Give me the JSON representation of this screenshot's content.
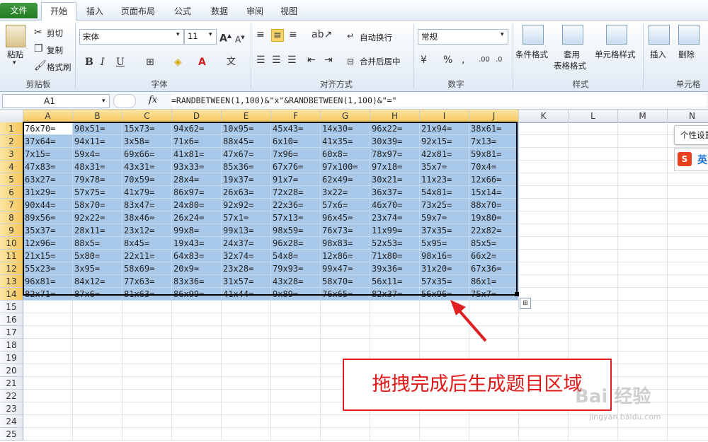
{
  "tabs": [
    "文件",
    "开始",
    "插入",
    "页面布局",
    "公式",
    "数据",
    "审阅",
    "视图"
  ],
  "clipboard": {
    "paste": "粘贴",
    "cut": "剪切",
    "copy": "复制",
    "format_painter": "格式刷",
    "label": "剪贴板"
  },
  "font": {
    "name": "宋体",
    "size": "11",
    "label": "字体"
  },
  "alignment": {
    "wrap": "自动换行",
    "merge": "合并后居中",
    "label": "对齐方式"
  },
  "number": {
    "format": "常规",
    "label": "数字"
  },
  "styles": {
    "conditional": "条件格式",
    "table1": "套用",
    "table2": "表格格式",
    "cell_styles": "单元格样式",
    "label": "样式"
  },
  "cells": {
    "insert": "插入",
    "delete": "删除",
    "label": "单元格"
  },
  "formula_bar": {
    "name_box": "A1",
    "fx": "fx",
    "formula": "=RANDBETWEEN(1,100)&\"x\"&RANDBETWEEN(1,100)&\"=\""
  },
  "columns": [
    "A",
    "B",
    "C",
    "D",
    "E",
    "F",
    "G",
    "H",
    "I",
    "J",
    "K",
    "L",
    "M",
    "N"
  ],
  "rows": [
    "1",
    "2",
    "3",
    "4",
    "5",
    "6",
    "7",
    "8",
    "9",
    "10",
    "11",
    "12",
    "13",
    "14",
    "15",
    "16",
    "17",
    "18",
    "19",
    "20",
    "21",
    "22",
    "23",
    "24",
    "25"
  ],
  "grid": [
    [
      "76x70=",
      "90x51=",
      "15x73=",
      "94x62=",
      "10x95=",
      "45x43=",
      "14x30=",
      "96x22=",
      "21x94=",
      "38x61="
    ],
    [
      "37x64=",
      "94x11=",
      "3x58=",
      "71x6=",
      "88x45=",
      "6x10=",
      "41x35=",
      "30x39=",
      "92x15=",
      "7x13="
    ],
    [
      "7x15=",
      "59x4=",
      "69x66=",
      "41x81=",
      "47x67=",
      "7x96=",
      "60x8=",
      "78x97=",
      "42x81=",
      "59x81="
    ],
    [
      "47x83=",
      "48x31=",
      "43x31=",
      "93x33=",
      "85x36=",
      "67x76=",
      "97x100=",
      "97x18=",
      "35x7=",
      "70x4="
    ],
    [
      "63x27=",
      "79x78=",
      "70x59=",
      "28x4=",
      "19x37=",
      "91x7=",
      "62x49=",
      "30x21=",
      "11x23=",
      "12x66="
    ],
    [
      "31x29=",
      "57x75=",
      "41x79=",
      "86x97=",
      "26x63=",
      "72x28=",
      "3x22=",
      "36x37=",
      "54x81=",
      "15x14="
    ],
    [
      "90x44=",
      "58x70=",
      "83x47=",
      "24x80=",
      "92x92=",
      "22x36=",
      "57x6=",
      "46x70=",
      "73x25=",
      "88x70="
    ],
    [
      "89x56=",
      "92x22=",
      "38x46=",
      "26x24=",
      "57x1=",
      "57x13=",
      "96x45=",
      "23x74=",
      "59x7=",
      "19x80="
    ],
    [
      "35x37=",
      "28x11=",
      "23x12=",
      "99x8=",
      "99x13=",
      "98x59=",
      "76x73=",
      "11x99=",
      "37x35=",
      "22x82="
    ],
    [
      "12x96=",
      "88x5=",
      "8x45=",
      "19x43=",
      "24x37=",
      "96x28=",
      "98x83=",
      "52x53=",
      "5x95=",
      "85x5="
    ],
    [
      "21x15=",
      "5x80=",
      "22x11=",
      "64x83=",
      "32x74=",
      "54x8=",
      "12x86=",
      "71x80=",
      "98x16=",
      "66x2="
    ],
    [
      "55x23=",
      "3x95=",
      "58x69=",
      "20x9=",
      "23x28=",
      "79x93=",
      "99x47=",
      "39x36=",
      "31x20=",
      "67x36="
    ],
    [
      "96x81=",
      "84x12=",
      "77x63=",
      "83x36=",
      "31x57=",
      "43x28=",
      "58x70=",
      "56x11=",
      "57x35=",
      "86x1="
    ],
    [
      "82x71=",
      "87x6=",
      "81x63=",
      "86x99=",
      "41x44=",
      "9x89=",
      "76x65=",
      "82x37=",
      "56x96=",
      "75x7="
    ]
  ],
  "tooltip": "个性设置",
  "ime_label": "英",
  "annotation": "拖拽完成后生成题目区域",
  "watermark": {
    "main": "Bai 经验",
    "sub": "jingyan.baidu.com"
  }
}
